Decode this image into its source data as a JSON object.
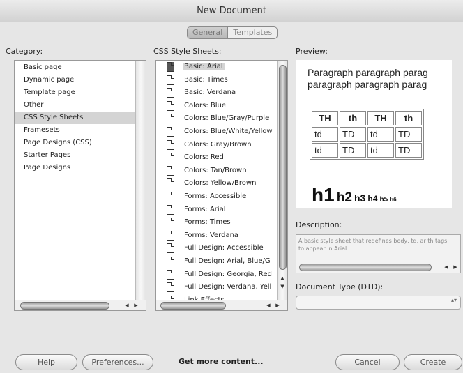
{
  "window": {
    "title": "New Document"
  },
  "tabs": [
    {
      "label": "General"
    },
    {
      "label": "Templates"
    }
  ],
  "category": {
    "label": "Category:",
    "items": [
      "Basic page",
      "Dynamic page",
      "Template page",
      "Other",
      "CSS Style Sheets",
      "Framesets",
      "Page Designs (CSS)",
      "Starter Pages",
      "Page Designs"
    ],
    "selected": "CSS Style Sheets"
  },
  "css_sheets": {
    "label": "CSS Style Sheets:",
    "items": [
      "Basic: Arial",
      "Basic: Times",
      "Basic: Verdana",
      "Colors: Blue",
      "Colors: Blue/Gray/Purple",
      "Colors: Blue/White/Yellow",
      "Colors: Gray/Brown",
      "Colors: Red",
      "Colors: Tan/Brown",
      "Colors: Yellow/Brown",
      "Forms: Accessible",
      "Forms: Arial",
      "Forms: Times",
      "Forms: Verdana",
      "Full Design: Accessible",
      "Full Design: Arial, Blue/G",
      "Full Design: Georgia, Red",
      "Full Design: Verdana, Yell",
      "Link Effects"
    ],
    "selected": "Basic: Arial"
  },
  "preview": {
    "label": "Preview:",
    "paragraph_lines": [
      "Paragraph paragraph parag",
      "paragraph paragraph parag"
    ],
    "table_header": [
      "TH",
      "th",
      "TH",
      "th"
    ],
    "table_rows": [
      [
        "td",
        "TD",
        "td",
        "TD"
      ],
      [
        "td",
        "TD",
        "td",
        "TD"
      ]
    ],
    "headings": [
      "h1",
      "h2",
      "h3",
      "h4",
      "h5",
      "h6"
    ]
  },
  "description": {
    "label": "Description:",
    "text": "A basic style sheet that redefines body, td, ar th tags to appear in Arial."
  },
  "doctype": {
    "label": "Document Type (DTD):",
    "value": ""
  },
  "buttons": {
    "help": "Help",
    "preferences": "Preferences...",
    "get_more": "Get more content...",
    "cancel": "Cancel",
    "create": "Create"
  },
  "icons": {
    "scroll_left": "◀",
    "scroll_right": "▶",
    "scroll_up": "▲",
    "scroll_down": "▼",
    "select_arrows": "▴▾"
  }
}
